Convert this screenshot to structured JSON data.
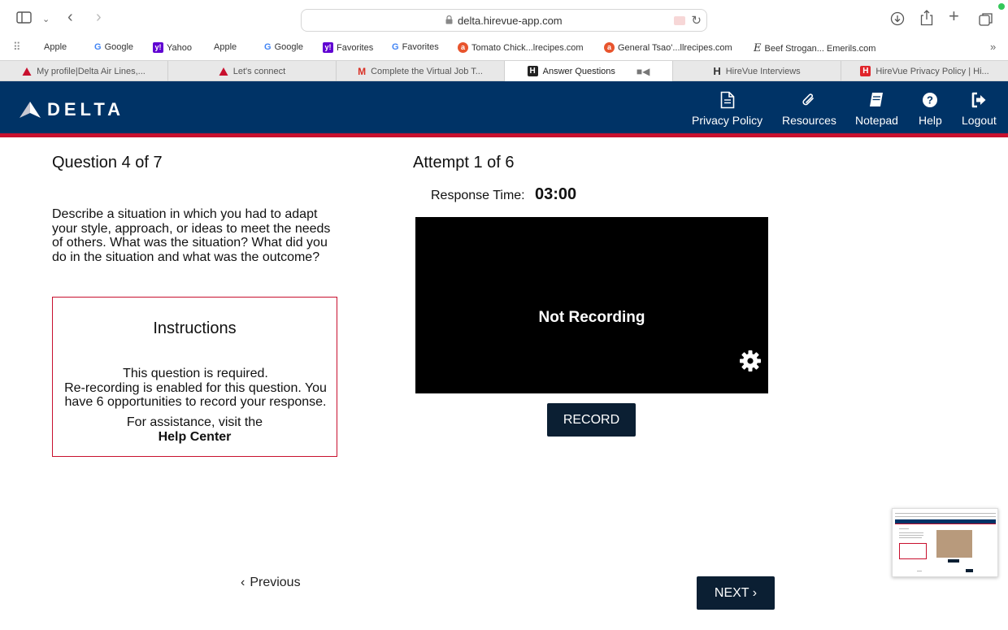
{
  "browser": {
    "url": "delta.hirevue-app.com",
    "bookmarks": [
      {
        "label": "Apple",
        "icon": "apple-icon"
      },
      {
        "label": "Google",
        "icon": "google-icon"
      },
      {
        "label": "Yahoo",
        "icon": "yahoo-icon"
      },
      {
        "label": "Apple",
        "icon": "apple-icon"
      },
      {
        "label": "Google",
        "icon": "google-icon"
      },
      {
        "label": "Favorites",
        "icon": "yahoo-icon"
      },
      {
        "label": "Favorites",
        "icon": "google-icon"
      },
      {
        "label": "Tomato Chick...lrecipes.com",
        "icon": "allrecipes-icon"
      },
      {
        "label": "General Tsao'...llrecipes.com",
        "icon": "allrecipes-icon"
      },
      {
        "label": "Beef Strogan... Emerils.com",
        "icon": "emerils-icon"
      }
    ],
    "tabs": [
      {
        "label": "My profile|Delta Air Lines,...",
        "icon": "delta-icon"
      },
      {
        "label": "Let's connect",
        "icon": "delta-icon"
      },
      {
        "label": "Complete the Virtual Job T...",
        "icon": "gmail-icon"
      },
      {
        "label": "Answer Questions",
        "icon": "hirevue-icon",
        "active": true
      },
      {
        "label": "HireVue Interviews",
        "icon": "hirevue-icon"
      },
      {
        "label": "HireVue Privacy Policy | Hi...",
        "icon": "hirevue-red-icon"
      }
    ]
  },
  "header": {
    "logo": "DELTA",
    "nav": [
      {
        "label": "Privacy Policy",
        "icon": "document-icon"
      },
      {
        "label": "Resources",
        "icon": "paperclip-icon"
      },
      {
        "label": "Notepad",
        "icon": "notepad-icon"
      },
      {
        "label": "Help",
        "icon": "help-icon"
      },
      {
        "label": "Logout",
        "icon": "logout-icon"
      }
    ]
  },
  "question": {
    "counter": "Question 4 of 7",
    "text": "Describe a situation in which you had to adapt your style, approach, or ideas to meet the needs of others. What was the situation? What did you do in the situation and what was the outcome?"
  },
  "instructions": {
    "title": "Instructions",
    "body_1": "This question is required.",
    "body_2": "Re-recording is enabled for this question. You have 6 opportunities to record your response.",
    "assist": "For assistance, visit the",
    "link": "Help Center"
  },
  "recorder": {
    "attempt": "Attempt 1 of 6",
    "response_label": "Response Time:",
    "response_time": "03:00",
    "status": "Not Recording",
    "record_label": "RECORD"
  },
  "navigation": {
    "previous": "Previous",
    "next": "NEXT"
  },
  "colors": {
    "delta_blue": "#003366",
    "delta_red": "#c8102e",
    "button_dark": "#0b1f33"
  }
}
